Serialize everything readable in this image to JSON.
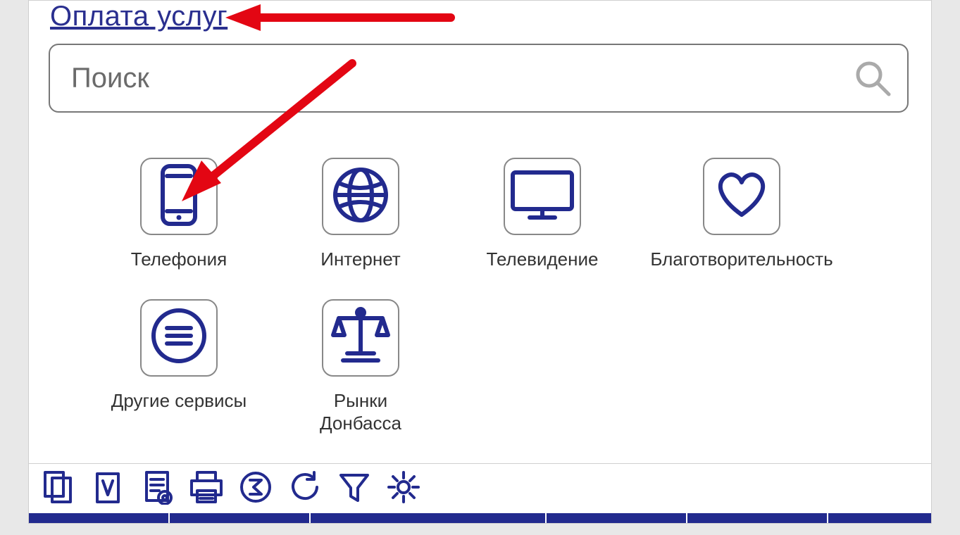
{
  "heading": "Оплата услуг",
  "search": {
    "placeholder": "Поиск"
  },
  "categories": [
    {
      "key": "telephony",
      "label": "Телефония",
      "icon": "phone-icon"
    },
    {
      "key": "internet",
      "label": "Интернет",
      "icon": "globe-icon"
    },
    {
      "key": "tv",
      "label": "Телевидение",
      "icon": "tv-icon"
    },
    {
      "key": "charity",
      "label": "Благотворительность",
      "icon": "heart-icon"
    },
    {
      "key": "other",
      "label": "Другие сервисы",
      "icon": "list-icon"
    },
    {
      "key": "markets",
      "label": "Рынки\nДонбасса",
      "icon": "scales-icon"
    }
  ],
  "toolbar": [
    {
      "name": "copy-icon"
    },
    {
      "name": "paste-icon"
    },
    {
      "name": "doc-config-icon"
    },
    {
      "name": "print-icon"
    },
    {
      "name": "sum-icon"
    },
    {
      "name": "refresh-icon"
    },
    {
      "name": "filter-icon"
    },
    {
      "name": "settings-icon"
    }
  ],
  "colors": {
    "brand": "#222a8e",
    "arrow": "#e30613"
  }
}
